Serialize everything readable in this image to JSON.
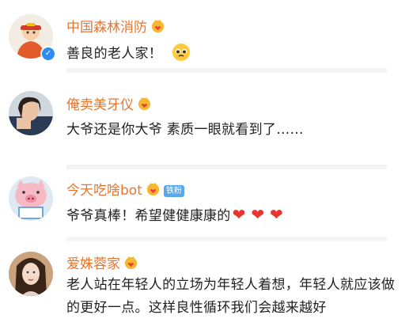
{
  "comments": [
    {
      "username": "中国森林消防",
      "text": "善良的老人家！",
      "has_verified_badge": true,
      "trailing_emoji": "pleading-face"
    },
    {
      "username": "俺卖美牙仪",
      "text": "大爷还是你大爷  素质一眼就看到了……"
    },
    {
      "username": "今天吃啥bot",
      "badge_label": "铁粉",
      "text": "爷爷真棒！希望健健康康的",
      "trailing_hearts": "❤ ❤ ❤"
    },
    {
      "username": "爱姝蓉家",
      "text": "老人站在年轻人的立场为年轻人着想，年轻人就应该做的更好一点。这样良性循环我们会越来越好"
    }
  ],
  "colors": {
    "username": "#e5762f",
    "text": "#222222",
    "heart": "#e8352f",
    "verified": "#2d8cf0",
    "badge_iron": "#5aa8e8"
  }
}
